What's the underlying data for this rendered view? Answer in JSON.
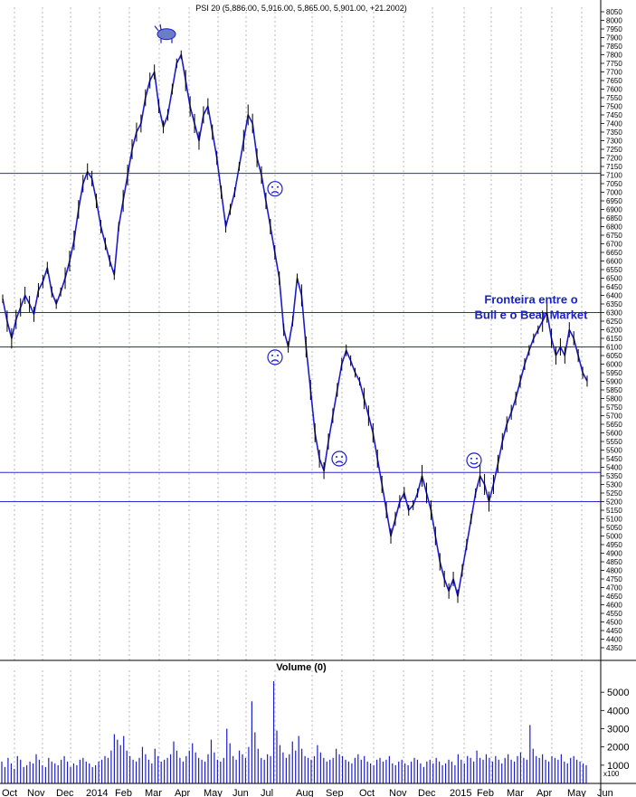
{
  "chart_data": [
    {
      "type": "line",
      "title": "PSI 20 (5,886.00, 5,916.00, 5,865.00, 5,901.00, +21.2002)",
      "xlabel": "",
      "ylabel": "",
      "x_ticks": [
        "Oct",
        "Nov",
        "Dec",
        "2014",
        "Feb",
        "Mar",
        "Apr",
        "May",
        "Jun",
        "Jul",
        "Aug",
        "Sep",
        "Oct",
        "Nov",
        "Dec",
        "2015",
        "Feb",
        "Mar",
        "Apr",
        "May",
        "Jun"
      ],
      "ylim": [
        4300,
        8080
      ],
      "y_ticks": [
        4350,
        4400,
        4450,
        4500,
        4550,
        4600,
        4650,
        4700,
        4750,
        4800,
        4850,
        4900,
        4950,
        5000,
        5050,
        5100,
        5150,
        5200,
        5250,
        5300,
        5350,
        5400,
        5450,
        5500,
        5550,
        5600,
        5650,
        5700,
        5750,
        5800,
        5850,
        5900,
        5950,
        6000,
        6050,
        6100,
        6150,
        6200,
        6250,
        6300,
        6350,
        6400,
        6450,
        6500,
        6550,
        6600,
        6650,
        6700,
        6750,
        6800,
        6850,
        6900,
        6950,
        7000,
        7050,
        7100,
        7150,
        7200,
        7250,
        7300,
        7350,
        7400,
        7450,
        7500,
        7550,
        7600,
        7650,
        7700,
        7750,
        7800,
        7850,
        7900,
        7950,
        8000,
        8050
      ],
      "series": [
        {
          "values": [
            6380,
            6250,
            6150,
            6260,
            6330,
            6400,
            6350,
            6290,
            6430,
            6480,
            6560,
            6420,
            6350,
            6420,
            6500,
            6600,
            6720,
            6900,
            7050,
            7120,
            7080,
            6950,
            6800,
            6700,
            6600,
            6520,
            6800,
            6950,
            7100,
            7250,
            7350,
            7400,
            7550,
            7650,
            7700,
            7500,
            7380,
            7450,
            7600,
            7750,
            7800,
            7650,
            7500,
            7400,
            7300,
            7450,
            7500,
            7350,
            7200,
            7000,
            6800,
            6900,
            7000,
            7150,
            7300,
            7450,
            7400,
            7200,
            7100,
            6950,
            6800,
            6650,
            6500,
            6200,
            6100,
            6250,
            6500,
            6400,
            6100,
            5850,
            5600,
            5450,
            5380,
            5550,
            5700,
            5850,
            6000,
            6080,
            6020,
            5950,
            5900,
            5800,
            5700,
            5600,
            5450,
            5300,
            5150,
            5000,
            5100,
            5200,
            5250,
            5150,
            5180,
            5250,
            5350,
            5250,
            5150,
            5000,
            4850,
            4750,
            4680,
            4750,
            4650,
            4800,
            4950,
            5100,
            5250,
            5350,
            5300,
            5200,
            5300,
            5420,
            5550,
            5650,
            5720,
            5800,
            5900,
            6000,
            6080,
            6150,
            6200,
            6250,
            6300,
            6150,
            6050,
            6100,
            6050,
            6200,
            6150,
            6050,
            5950,
            5901
          ]
        }
      ],
      "hlines": [
        7110,
        6300,
        6100,
        5370,
        5200
      ],
      "annotations": [
        {
          "text": "Fronteira entre o",
          "value": 6380
        },
        {
          "text": "Bull e o Bear Market",
          "value": 6290
        }
      ],
      "markers": [
        {
          "icon": "bull-icon",
          "value": 7920
        },
        {
          "icon": "sad-face-icon",
          "value": 7020
        },
        {
          "icon": "sad-face-icon",
          "value": 6040
        },
        {
          "icon": "sad-face-icon",
          "value": 5450
        },
        {
          "icon": "smiley-face-icon",
          "value": 5440
        }
      ],
      "colors": {
        "price": "#1c1ccc",
        "hline": "#2a2acc",
        "annotation": "#1a22c8",
        "grid": "#888888"
      }
    },
    {
      "type": "bar",
      "title": "Volume (0)",
      "ylim": [
        0,
        5900
      ],
      "y_ticks": [
        1000,
        2000,
        3000,
        4000,
        5000
      ],
      "unit_label": "x100",
      "values": [
        1200,
        900,
        1400,
        1100,
        800,
        1500,
        1300,
        900,
        1000,
        1200,
        1100,
        1600,
        1300,
        1000,
        900,
        1400,
        1200,
        1100,
        1000,
        1300,
        1500,
        1200,
        900,
        1100,
        1000,
        1300,
        1400,
        1200,
        1100,
        900,
        1000,
        1200,
        1300,
        1500,
        1400,
        1800,
        2700,
        2400,
        2100,
        2600,
        1800,
        1500,
        1300,
        1200,
        1400,
        2000,
        1600,
        1300,
        1100,
        1900,
        1500,
        1200,
        1300,
        1400,
        1600,
        2300,
        1800,
        1400,
        1200,
        1500,
        1800,
        2200,
        1700,
        1400,
        1300,
        1200,
        1600,
        2400,
        1700,
        1300,
        1200,
        1400,
        3000,
        2200,
        1500,
        1300,
        1800,
        1600,
        1400,
        2000,
        4500,
        2800,
        1900,
        1400,
        1300,
        1600,
        1500,
        5600,
        2900,
        2100,
        1700,
        1400,
        1600,
        2300,
        1800,
        2600,
        1900,
        1500,
        1400,
        1300,
        1500,
        2100,
        1700,
        1400,
        1200,
        1300,
        1400,
        1900,
        1600,
        1500,
        1300,
        1200,
        1100,
        1400,
        1600,
        1300,
        1500,
        1200,
        1100,
        1000,
        1300,
        1400,
        1200,
        1300,
        1500,
        1100,
        1000,
        1200,
        1300,
        1100,
        1000,
        1200,
        1400,
        1300,
        1100,
        900,
        1200,
        1300,
        1100,
        1400,
        1200,
        1000,
        1100,
        1300,
        1200,
        1000,
        1600,
        1300,
        1100,
        1500,
        1400,
        1200,
        1800,
        1400,
        1300,
        1600,
        1400,
        1200,
        1500,
        1300,
        1100,
        1400,
        1600,
        1300,
        1200,
        1500,
        1700,
        1400,
        1300,
        3200,
        1900,
        1500,
        1400,
        1600,
        1300,
        1200,
        1500,
        1400,
        1300,
        1600,
        1200,
        1100,
        1400,
        1500,
        1300,
        1200,
        1100,
        1000
      ]
    }
  ]
}
